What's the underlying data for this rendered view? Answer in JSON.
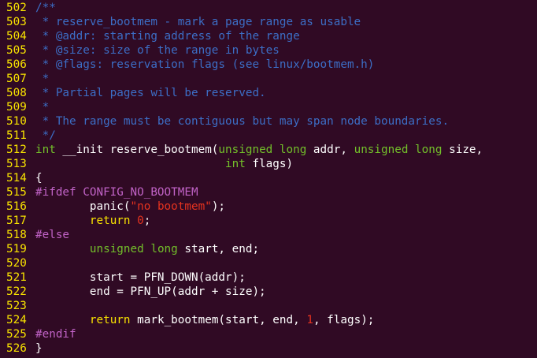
{
  "editor": {
    "lines": [
      {
        "num": "502",
        "tokens": [
          {
            "t": "/**",
            "c": "comment"
          }
        ]
      },
      {
        "num": "503",
        "tokens": [
          {
            "t": " * reserve_bootmem - mark a page range as usable",
            "c": "comment"
          }
        ]
      },
      {
        "num": "504",
        "tokens": [
          {
            "t": " * @addr: starting address of the range",
            "c": "comment"
          }
        ]
      },
      {
        "num": "505",
        "tokens": [
          {
            "t": " * @size: size of the range in bytes",
            "c": "comment"
          }
        ]
      },
      {
        "num": "506",
        "tokens": [
          {
            "t": " * @flags: reservation flags (see linux/bootmem.h)",
            "c": "comment"
          }
        ]
      },
      {
        "num": "507",
        "tokens": [
          {
            "t": " *",
            "c": "comment"
          }
        ]
      },
      {
        "num": "508",
        "tokens": [
          {
            "t": " * Partial pages will be reserved.",
            "c": "comment"
          }
        ]
      },
      {
        "num": "509",
        "tokens": [
          {
            "t": " *",
            "c": "comment"
          }
        ]
      },
      {
        "num": "510",
        "tokens": [
          {
            "t": " * The range must be contiguous but may span node boundaries.",
            "c": "comment"
          }
        ]
      },
      {
        "num": "511",
        "tokens": [
          {
            "t": " */",
            "c": "comment"
          }
        ]
      },
      {
        "num": "512",
        "tokens": [
          {
            "t": "int",
            "c": "type"
          },
          {
            "t": " __init reserve_bootmem(",
            "c": "plain"
          },
          {
            "t": "unsigned long",
            "c": "type"
          },
          {
            "t": " addr, ",
            "c": "plain"
          },
          {
            "t": "unsigned long",
            "c": "type"
          },
          {
            "t": " size,",
            "c": "plain"
          }
        ]
      },
      {
        "num": "513",
        "tokens": [
          {
            "t": "                            ",
            "c": "plain"
          },
          {
            "t": "int",
            "c": "type"
          },
          {
            "t": " flags)",
            "c": "plain"
          }
        ]
      },
      {
        "num": "514",
        "tokens": [
          {
            "t": "{",
            "c": "plain"
          }
        ]
      },
      {
        "num": "515",
        "tokens": [
          {
            "t": "#ifdef CONFIG_NO_BOOTMEM",
            "c": "pre"
          }
        ]
      },
      {
        "num": "516",
        "tokens": [
          {
            "t": "        panic(",
            "c": "plain"
          },
          {
            "t": "\"no bootmem\"",
            "c": "str"
          },
          {
            "t": ");",
            "c": "plain"
          }
        ]
      },
      {
        "num": "517",
        "tokens": [
          {
            "t": "        ",
            "c": "plain"
          },
          {
            "t": "return",
            "c": "kw"
          },
          {
            "t": " ",
            "c": "plain"
          },
          {
            "t": "0",
            "c": "num"
          },
          {
            "t": ";",
            "c": "plain"
          }
        ]
      },
      {
        "num": "518",
        "tokens": [
          {
            "t": "#else",
            "c": "pre"
          }
        ]
      },
      {
        "num": "519",
        "tokens": [
          {
            "t": "        ",
            "c": "plain"
          },
          {
            "t": "unsigned long",
            "c": "type"
          },
          {
            "t": " start, end;",
            "c": "plain"
          }
        ]
      },
      {
        "num": "520",
        "tokens": []
      },
      {
        "num": "521",
        "tokens": [
          {
            "t": "        start = PFN_DOWN(addr);",
            "c": "plain"
          }
        ]
      },
      {
        "num": "522",
        "tokens": [
          {
            "t": "        end = PFN_UP(addr + size);",
            "c": "plain"
          }
        ]
      },
      {
        "num": "523",
        "tokens": []
      },
      {
        "num": "524",
        "tokens": [
          {
            "t": "        ",
            "c": "plain"
          },
          {
            "t": "return",
            "c": "kw"
          },
          {
            "t": " mark_bootmem(start, end, ",
            "c": "plain"
          },
          {
            "t": "1",
            "c": "num"
          },
          {
            "t": ", flags);",
            "c": "plain"
          }
        ]
      },
      {
        "num": "525",
        "tokens": [
          {
            "t": "#endif",
            "c": "pre"
          }
        ]
      },
      {
        "num": "526",
        "tokens": [
          {
            "t": "}",
            "c": "plain"
          }
        ]
      }
    ]
  },
  "colors": {
    "background": "#300a24",
    "line_number": "#f8e300",
    "comment": "#3c6ec6",
    "type": "#73c02a",
    "keyword": "#f8e300",
    "preprocessor": "#c163c7",
    "string": "#e5331f",
    "plain": "#ffffff"
  }
}
